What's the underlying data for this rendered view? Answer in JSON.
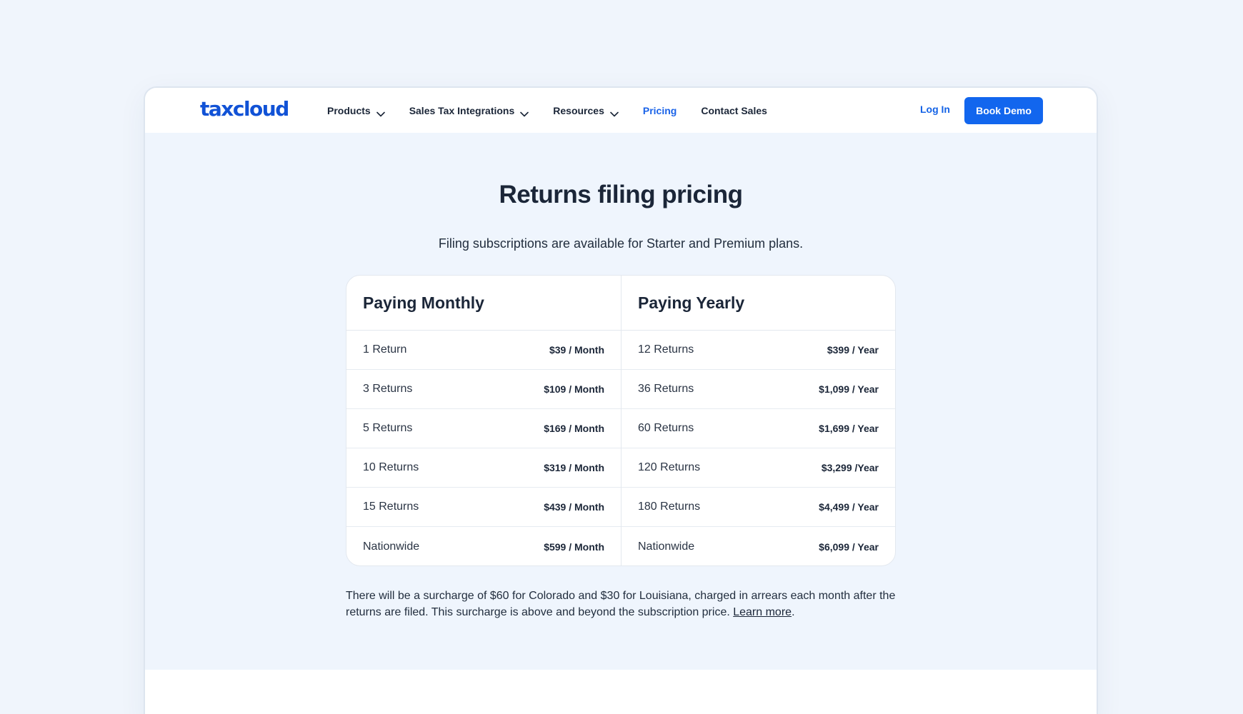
{
  "nav": {
    "logo": "taxcloud",
    "items": [
      {
        "label": "Products",
        "dropdown": true,
        "active": false
      },
      {
        "label": "Sales Tax Integrations",
        "dropdown": true,
        "active": false
      },
      {
        "label": "Resources",
        "dropdown": true,
        "active": false
      },
      {
        "label": "Pricing",
        "dropdown": false,
        "active": true
      },
      {
        "label": "Contact Sales",
        "dropdown": false,
        "active": false
      }
    ],
    "login": "Log In",
    "cta": "Book Demo"
  },
  "hero": {
    "title": "Returns filing pricing",
    "subtitle": "Filing subscriptions are available for Starter and Premium plans."
  },
  "pricing": {
    "monthly": {
      "heading": "Paying Monthly",
      "rows": [
        {
          "name": "1 Return",
          "price": "$39 / Month"
        },
        {
          "name": "3 Returns",
          "price": "$109 / Month"
        },
        {
          "name": "5 Returns",
          "price": "$169 / Month"
        },
        {
          "name": "10 Returns",
          "price": "$319 / Month"
        },
        {
          "name": "15 Returns",
          "price": "$439 / Month"
        },
        {
          "name": "Nationwide",
          "price": "$599 / Month"
        }
      ]
    },
    "yearly": {
      "heading": "Paying Yearly",
      "rows": [
        {
          "name": "12 Returns",
          "price": "$399 / Year"
        },
        {
          "name": "36 Returns",
          "price": "$1,099 / Year"
        },
        {
          "name": "60 Returns",
          "price": "$1,699 / Year"
        },
        {
          "name": "120 Returns",
          "price": "$3,299 /Year"
        },
        {
          "name": "180 Returns",
          "price": "$4,499 / Year"
        },
        {
          "name": "Nationwide",
          "price": "$6,099 / Year"
        }
      ]
    }
  },
  "note": {
    "text": "There will be a surcharge of $60 for Colorado and $30 for Louisiana, charged in arrears each month after the returns are filed. This surcharge is above and beyond the subscription price. ",
    "link": "Learn more",
    "end": "."
  },
  "colors": {
    "brand": "#1152d6",
    "accent": "#1266ee",
    "background": "#eff5fd"
  }
}
